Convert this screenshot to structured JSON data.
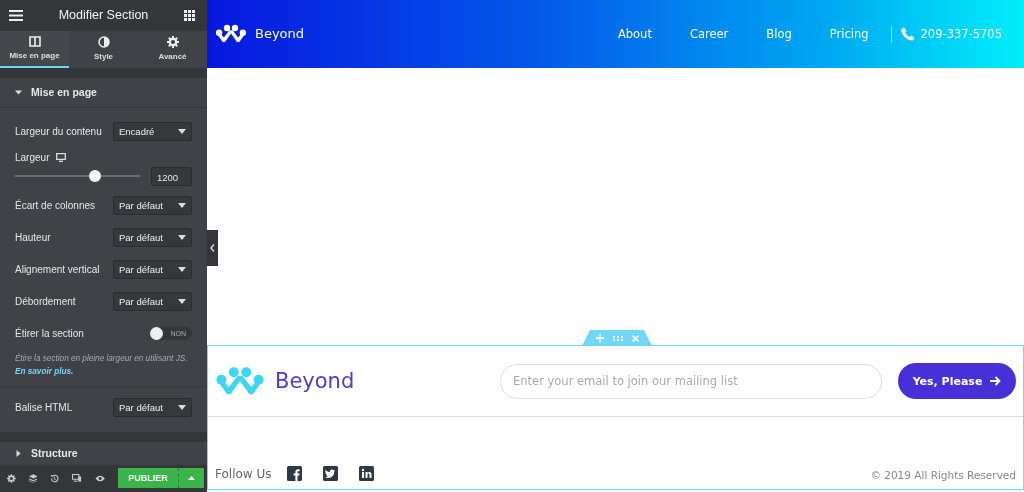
{
  "panel": {
    "title": "Modifier Section",
    "tabs": [
      {
        "label": "Mise en page",
        "selected": true
      },
      {
        "label": "Style",
        "selected": false
      },
      {
        "label": "Avancé",
        "selected": false
      }
    ],
    "section": {
      "title": "Mise en page",
      "expanded": true
    },
    "controls": [
      {
        "kind": "select",
        "label": "Largeur du contenu",
        "value": "Encadré"
      },
      {
        "kind": "slider",
        "label": "Largeur",
        "level": 0.64,
        "value": "1200"
      },
      {
        "kind": "select",
        "label": "Écart de colonnes",
        "value": "Par défaut"
      },
      {
        "kind": "select",
        "label": "Hauteur",
        "value": "Par défaut"
      },
      {
        "kind": "select",
        "label": "Alignement vertical",
        "value": "Par défaut"
      },
      {
        "kind": "select",
        "label": "Débordement",
        "value": "Par défaut"
      },
      {
        "kind": "switch",
        "label": "Étirer la section",
        "on": false,
        "text": "NON"
      },
      {
        "kind": "note",
        "text": "Étire la section en pleine largeur en utilisant JS.",
        "link": "En savoir plus."
      }
    ],
    "extra_controls": [
      {
        "kind": "select",
        "label": "Balise HTML",
        "value": "Par défaut"
      }
    ],
    "collapsed_section": {
      "title": "Structure",
      "expanded": false
    },
    "publish": "PUBLIER"
  },
  "site": {
    "brand": "Beyond",
    "nav": [
      "About",
      "Career",
      "Blog",
      "Pricing"
    ],
    "phone": "209-337-5705",
    "footer": {
      "brand": "Beyond",
      "email_placeholder": "Enter your email to join our mailing list",
      "button": "Yes, Please",
      "follow": "Follow Us",
      "copyright": "© 2019 All Rights Reserved"
    }
  }
}
